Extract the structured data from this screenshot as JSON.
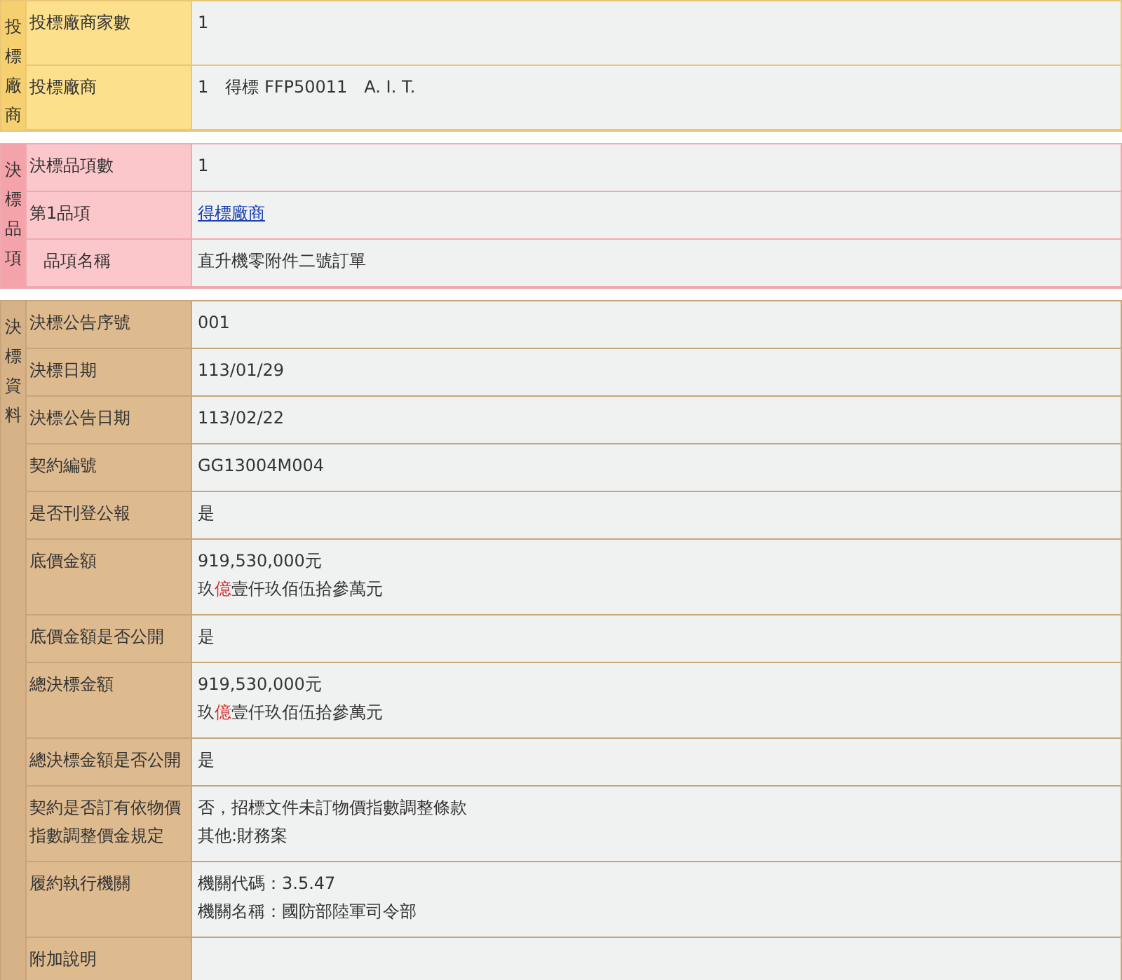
{
  "sections": [
    {
      "kind": "bidders",
      "title": "投標廠商",
      "rows": [
        {
          "label": "投標廠商家數",
          "indented": false,
          "lines": [
            {
              "kind": "text",
              "parts": [
                {
                  "text": "1",
                  "highlight": false
                }
              ]
            }
          ]
        },
        {
          "label": "投標廠商",
          "indented": false,
          "lines": [
            {
              "kind": "text",
              "parts": [
                {
                  "text": "1　得標 FFP50011　A. I. T.",
                  "highlight": false
                }
              ]
            }
          ]
        }
      ]
    },
    {
      "kind": "items",
      "title": "決標品項",
      "rows": [
        {
          "label": "決標品項數",
          "indented": false,
          "lines": [
            {
              "kind": "text",
              "parts": [
                {
                  "text": "1",
                  "highlight": false
                }
              ]
            }
          ]
        },
        {
          "label": "第1品項",
          "indented": false,
          "lines": [
            {
              "kind": "link",
              "parts": [
                {
                  "text": "得標廠商",
                  "highlight": false
                }
              ]
            }
          ]
        },
        {
          "label": "品項名稱",
          "indented": true,
          "lines": [
            {
              "kind": "text",
              "parts": [
                {
                  "text": "直升機零附件二號訂單",
                  "highlight": false
                }
              ]
            }
          ]
        }
      ]
    },
    {
      "kind": "award",
      "title": "決標資料",
      "rows": [
        {
          "label": "決標公告序號",
          "indented": false,
          "lines": [
            {
              "kind": "text",
              "parts": [
                {
                  "text": "001",
                  "highlight": false
                }
              ]
            }
          ]
        },
        {
          "label": "決標日期",
          "indented": false,
          "lines": [
            {
              "kind": "text",
              "parts": [
                {
                  "text": "113/01/29",
                  "highlight": false
                }
              ]
            }
          ]
        },
        {
          "label": "決標公告日期",
          "indented": false,
          "lines": [
            {
              "kind": "text",
              "parts": [
                {
                  "text": "113/02/22",
                  "highlight": false
                }
              ]
            }
          ]
        },
        {
          "label": "契約編號",
          "indented": false,
          "lines": [
            {
              "kind": "text",
              "parts": [
                {
                  "text": "GG13004M004",
                  "highlight": false
                }
              ]
            }
          ]
        },
        {
          "label": "是否刊登公報",
          "indented": false,
          "lines": [
            {
              "kind": "text",
              "parts": [
                {
                  "text": "是",
                  "highlight": false
                }
              ]
            }
          ]
        },
        {
          "label": "底價金額",
          "indented": false,
          "lines": [
            {
              "kind": "text",
              "parts": [
                {
                  "text": "919,530,000元",
                  "highlight": false
                }
              ]
            },
            {
              "kind": "text",
              "parts": [
                {
                  "text": "玖",
                  "highlight": false
                },
                {
                  "text": "億",
                  "highlight": true
                },
                {
                  "text": "壹仟玖佰伍拾參萬元",
                  "highlight": false
                }
              ]
            }
          ]
        },
        {
          "label": "底價金額是否公開",
          "indented": false,
          "lines": [
            {
              "kind": "text",
              "parts": [
                {
                  "text": "是",
                  "highlight": false
                }
              ]
            }
          ]
        },
        {
          "label": "總決標金額",
          "indented": false,
          "lines": [
            {
              "kind": "text",
              "parts": [
                {
                  "text": "919,530,000元",
                  "highlight": false
                }
              ]
            },
            {
              "kind": "text",
              "parts": [
                {
                  "text": "玖",
                  "highlight": false
                },
                {
                  "text": "億",
                  "highlight": true
                },
                {
                  "text": "壹仟玖佰伍拾參萬元",
                  "highlight": false
                }
              ]
            }
          ]
        },
        {
          "label": "總決標金額是否公開",
          "indented": false,
          "lines": [
            {
              "kind": "text",
              "parts": [
                {
                  "text": "是",
                  "highlight": false
                }
              ]
            }
          ]
        },
        {
          "label": "契約是否訂有依物價指數調整價金規定",
          "indented": false,
          "lines": [
            {
              "kind": "text",
              "parts": [
                {
                  "text": "否，招標文件未訂物價指數調整條款",
                  "highlight": false
                }
              ]
            },
            {
              "kind": "text",
              "parts": [
                {
                  "text": "其他:財務案",
                  "highlight": false
                }
              ]
            }
          ]
        },
        {
          "label": "履約執行機關",
          "indented": false,
          "lines": [
            {
              "kind": "text",
              "parts": [
                {
                  "text": "機關代碼：3.5.47",
                  "highlight": false
                }
              ]
            },
            {
              "kind": "text",
              "parts": [
                {
                  "text": "機關名稱：國防部陸軍司令部",
                  "highlight": false
                }
              ]
            }
          ]
        },
        {
          "label": "附加說明",
          "indented": false,
          "lines": []
        }
      ]
    }
  ]
}
